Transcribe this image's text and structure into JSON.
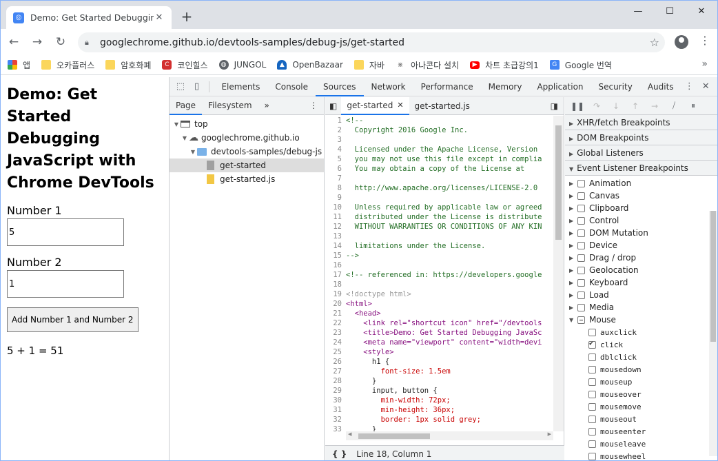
{
  "tab": {
    "title": "Demo: Get Started Debugging J",
    "favicon": "chrome-favicon"
  },
  "address": {
    "url": "googlechrome.github.io/devtools-samples/debug-js/get-started"
  },
  "bookmarks": [
    {
      "label": "앱",
      "icon": "apps-grid-icon"
    },
    {
      "label": "오카플러스",
      "icon": "folder-icon"
    },
    {
      "label": "암호화폐",
      "icon": "folder-icon"
    },
    {
      "label": "코인힐스",
      "icon": "coinhills-icon"
    },
    {
      "label": "JUNGOL",
      "icon": "globe-icon"
    },
    {
      "label": "OpenBazaar",
      "icon": "openbazaar-icon"
    },
    {
      "label": "자바",
      "icon": "folder-icon"
    },
    {
      "label": "아나콘다 설치",
      "icon": "anaconda-icon"
    },
    {
      "label": "차트 초급강의1",
      "icon": "youtube-icon"
    },
    {
      "label": "Google 번역",
      "icon": "translate-icon"
    }
  ],
  "page": {
    "heading": "Demo: Get Started Debugging JavaScript with Chrome DevTools",
    "label1": "Number 1",
    "value1": "5",
    "label2": "Number 2",
    "value2": "1",
    "button": "Add Number 1 and Number 2",
    "result": "5 + 1 = 51"
  },
  "devtools": {
    "tabs": [
      "Elements",
      "Console",
      "Sources",
      "Network",
      "Performance",
      "Memory",
      "Application",
      "Security",
      "Audits"
    ],
    "active_tab": "Sources",
    "navigator": {
      "tabs": [
        "Page",
        "Filesystem"
      ],
      "tree": [
        {
          "label": "top",
          "depth": 0,
          "icon": "frame-icon"
        },
        {
          "label": "googlechrome.github.io",
          "depth": 1,
          "icon": "cloud-icon"
        },
        {
          "label": "devtools-samples/debug-js",
          "depth": 2,
          "icon": "folder-icon"
        },
        {
          "label": "get-started",
          "depth": 3,
          "icon": "file-icon",
          "selected": true
        },
        {
          "label": "get-started.js",
          "depth": 3,
          "icon": "js-file-icon"
        }
      ]
    },
    "editor": {
      "tabs": [
        "get-started",
        "get-started.js"
      ],
      "status": "Line 18, Column 1",
      "lines": [
        "<!--",
        "  Copyright 2016 Google Inc.",
        "",
        "  Licensed under the Apache License, Version",
        "  you may not use this file except in complia",
        "  You may obtain a copy of the License at",
        "",
        "  http://www.apache.org/licenses/LICENSE-2.0",
        "",
        "  Unless required by applicable law or agreed",
        "  distributed under the License is distribute",
        "  WITHOUT WARRANTIES OR CONDITIONS OF ANY KIN",
        "",
        "  limitations under the License.",
        "-->",
        "",
        "<!-- referenced in: https://developers.google",
        "",
        "<!doctype html>",
        "<html>",
        "  <head>",
        "    <link rel=\"shortcut icon\" href=\"/devtools",
        "    <title>Demo: Get Started Debugging JavaSc",
        "    <meta name=\"viewport\" content=\"width=devi",
        "    <style>",
        "      h1 {",
        "        font-size: 1.5em",
        "      }",
        "      input, button {",
        "        min-width: 72px;",
        "        min-height: 36px;",
        "        border: 1px solid grey;",
        "      }",
        ""
      ]
    },
    "debugger": {
      "sections": [
        "XHR/fetch Breakpoints",
        "DOM Breakpoints",
        "Global Listeners",
        "Event Listener Breakpoints"
      ],
      "categories": [
        "Animation",
        "Canvas",
        "Clipboard",
        "Control",
        "DOM Mutation",
        "Device",
        "Drag / drop",
        "Geolocation",
        "Keyboard",
        "Load",
        "Media",
        "Mouse"
      ],
      "mouse_events": [
        {
          "name": "auxclick",
          "checked": false
        },
        {
          "name": "click",
          "checked": true
        },
        {
          "name": "dblclick",
          "checked": false
        },
        {
          "name": "mousedown",
          "checked": false
        },
        {
          "name": "mouseup",
          "checked": false
        },
        {
          "name": "mouseover",
          "checked": false
        },
        {
          "name": "mousemove",
          "checked": false
        },
        {
          "name": "mouseout",
          "checked": false
        },
        {
          "name": "mouseenter",
          "checked": false
        },
        {
          "name": "mouseleave",
          "checked": false
        },
        {
          "name": "mousewheel",
          "checked": false
        }
      ]
    }
  }
}
